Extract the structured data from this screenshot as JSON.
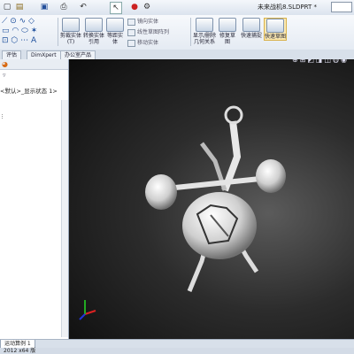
{
  "window": {
    "title": "未来战机8.SLDPRT *"
  },
  "ribbon": {
    "cut_extrude": "剪裁实体(T)",
    "convert_entities": "转换实体引用",
    "offset_entities": "等距实体",
    "mirror_entities": "镜向实体",
    "linear_pattern": "线性草图阵列",
    "move_entities": "移动实体",
    "show_delete_relations": "显示/删除几何关系",
    "repair_sketch": "修复草图",
    "quick_snaps": "快速捕捉",
    "rapid_sketch": "快速草图"
  },
  "tabs": [
    "评估",
    "DimXpert",
    "办公室产品"
  ],
  "feature_tree": {
    "root_label": "<默认>_显示状态 1>"
  },
  "bottom": {
    "motion_study_tab": "运动算例 1",
    "status_text": "2012 x64 版"
  },
  "icons": {
    "new": "new-file-icon",
    "open": "open-folder-icon",
    "save": "save-icon",
    "print": "print-icon",
    "undo": "undo-icon",
    "select": "select-arrow-icon",
    "rebuild": "rebuild-traffic-light-icon",
    "options": "options-gear-icon",
    "zoom_fit": "zoom-to-fit-icon",
    "zoom_area": "zoom-area-icon",
    "view_orientation": "view-orientation-icon",
    "display_style": "display-style-icon",
    "triad": "coordinate-triad-icon"
  },
  "colors": {
    "viewport_center": "#5b5b5b",
    "viewport_edge": "#0c0c0c",
    "triad_x": "#d22",
    "triad_y": "#2a2",
    "triad_z": "#23d"
  }
}
